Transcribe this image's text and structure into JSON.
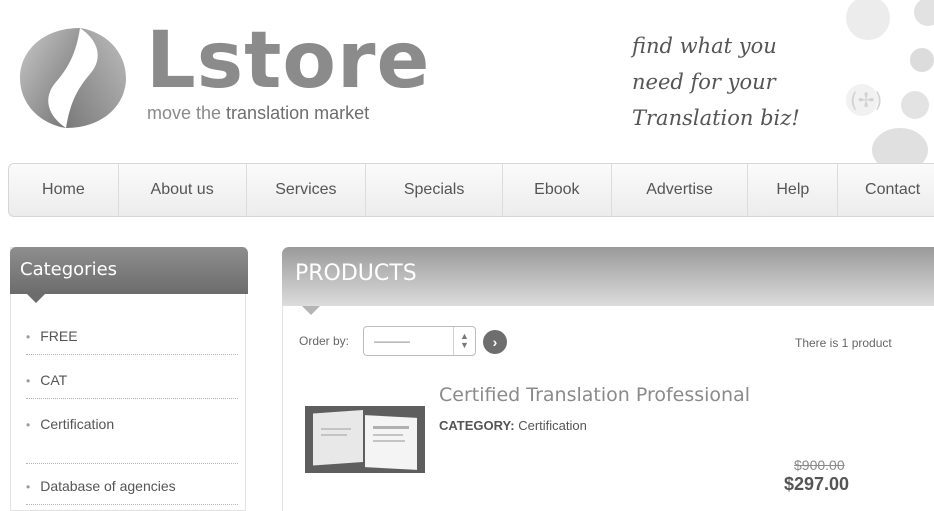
{
  "header": {
    "logo_text": "Lstore",
    "tagline_pre": "move the ",
    "tagline_bold": "translation market",
    "slogan": [
      "find what you",
      "need for your",
      "Translation biz!"
    ]
  },
  "nav": [
    "Home",
    "About us",
    "Services",
    "Specials",
    "Ebook",
    "Advertise",
    "Help",
    "Contact"
  ],
  "sidebar": {
    "title": "Categories",
    "items": [
      "FREE",
      "CAT",
      "Certification",
      "Database of agencies"
    ]
  },
  "products": {
    "title": "PRODUCTS",
    "order_label": "Order by:",
    "order_selected": "———",
    "count_text": "There is 1 product",
    "item": {
      "title": "Certified Translation Professional",
      "category_label": "CATEGORY:",
      "category_value": "Certification",
      "old_price": "$900.00",
      "new_price": "$297.00"
    }
  },
  "colors": {
    "header_gray": "#7a7a7a",
    "accent": "#6e6e6e"
  }
}
